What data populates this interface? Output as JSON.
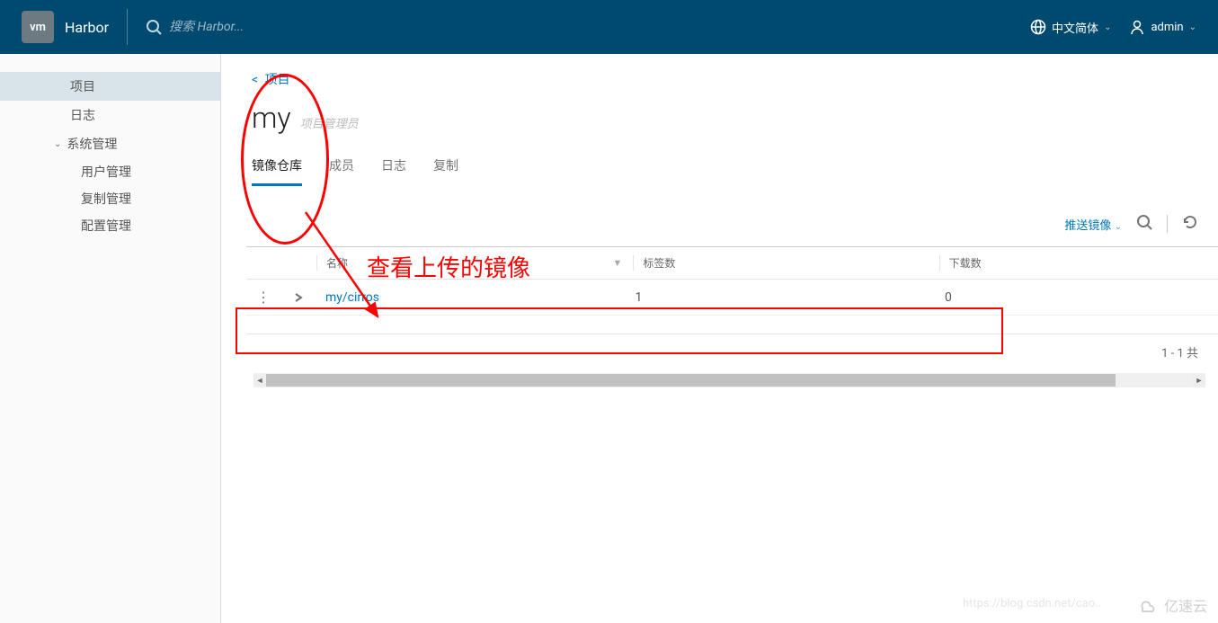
{
  "header": {
    "logo_text": "vm",
    "product": "Harbor",
    "search_placeholder": "搜索 Harbor...",
    "language": "中文简体",
    "user": "admin"
  },
  "sidebar": {
    "projects": "项目",
    "logs": "日志",
    "system_mgmt": "系统管理",
    "user_mgmt": "用户管理",
    "replication_mgmt": "复制管理",
    "config_mgmt": "配置管理"
  },
  "breadcrumb": {
    "back_label": "项目"
  },
  "project": {
    "name": "my",
    "role": "项目管理员"
  },
  "tabs": {
    "image_repo": "镜像仓库",
    "members": "成员",
    "logs": "日志",
    "replication": "复制"
  },
  "toolbar": {
    "push_image": "推送镜像"
  },
  "table": {
    "columns": {
      "name": "名称",
      "tags": "标签数",
      "downloads": "下载数"
    },
    "rows": [
      {
        "name": "my/cirros",
        "tags": "1",
        "downloads": "0"
      }
    ],
    "footer": "1 - 1 共"
  },
  "annotations": {
    "view_uploaded": "查看上传的镜像"
  },
  "watermarks": {
    "url": "https://blog.csdn.net/cao..",
    "brand": "亿速云"
  }
}
